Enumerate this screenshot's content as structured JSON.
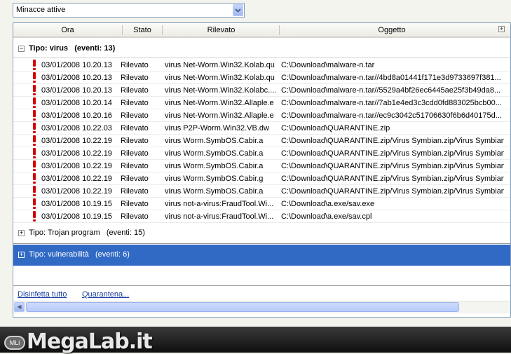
{
  "filter": {
    "selected": "Minacce attive"
  },
  "columns": {
    "ora": "Ora",
    "stato": "Stato",
    "rilevato": "Rilevato",
    "oggetto": "Oggetto"
  },
  "groups": [
    {
      "label": "Tipo: virus   (eventi: 13)",
      "expanded": true,
      "expander": "−"
    },
    {
      "label": "Tipo: Trojan program   (eventi: 15)",
      "expanded": false,
      "expander": "+"
    },
    {
      "label": "Tipo: vulnerabilità   (eventi: 6)",
      "expanded": false,
      "expander": "+",
      "selected": true
    }
  ],
  "rows": [
    {
      "ora": "03/01/2008 10.20.13",
      "stato": "Rilevato",
      "rilevato": "virus Net-Worm.Win32.Kolab.qu",
      "oggetto": "C:\\Download\\malware-n.tar"
    },
    {
      "ora": "03/01/2008 10.20.13",
      "stato": "Rilevato",
      "rilevato": "virus Net-Worm.Win32.Kolab.qu",
      "oggetto": "C:\\Download\\malware-n.tar//4bd8a01441f171e3d9733697f381..."
    },
    {
      "ora": "03/01/2008 10.20.13",
      "stato": "Rilevato",
      "rilevato": "virus Net-Worm.Win32.Kolabc....",
      "oggetto": "C:\\Download\\malware-n.tar//5529a4bf26ec6445ae25f3b49da8..."
    },
    {
      "ora": "03/01/2008 10.20.14",
      "stato": "Rilevato",
      "rilevato": "virus Net-Worm.Win32.Allaple.e",
      "oggetto": "C:\\Download\\malware-n.tar//7ab1e4ed3c3cdd0fd883025bcb00..."
    },
    {
      "ora": "03/01/2008 10.20.16",
      "stato": "Rilevato",
      "rilevato": "virus Net-Worm.Win32.Allaple.e",
      "oggetto": "C:\\Download\\malware-n.tar//ec9c3042c51706630f6b6d40175d..."
    },
    {
      "ora": "03/01/2008 10.22.03",
      "stato": "Rilevato",
      "rilevato": "virus P2P-Worm.Win32.VB.dw",
      "oggetto": "C:\\Download\\QUARANTINE.zip"
    },
    {
      "ora": "03/01/2008 10.22.19",
      "stato": "Rilevato",
      "rilevato": "virus Worm.SymbOS.Cabir.a",
      "oggetto": "C:\\Download\\QUARANTINE.zip/Virus Symbian.zip/Virus Symbian..."
    },
    {
      "ora": "03/01/2008 10.22.19",
      "stato": "Rilevato",
      "rilevato": "virus Worm.SymbOS.Cabir.a",
      "oggetto": "C:\\Download\\QUARANTINE.zip/Virus Symbian.zip/Virus Symbian..."
    },
    {
      "ora": "03/01/2008 10.22.19",
      "stato": "Rilevato",
      "rilevato": "virus Worm.SymbOS.Cabir.a",
      "oggetto": "C:\\Download\\QUARANTINE.zip/Virus Symbian.zip/Virus Symbian..."
    },
    {
      "ora": "03/01/2008 10.22.19",
      "stato": "Rilevato",
      "rilevato": "virus Worm.SymbOS.Cabir.g",
      "oggetto": "C:\\Download\\QUARANTINE.zip/Virus Symbian.zip/Virus Symbian..."
    },
    {
      "ora": "03/01/2008 10.22.19",
      "stato": "Rilevato",
      "rilevato": "virus Worm.SymbOS.Cabir.a",
      "oggetto": "C:\\Download\\QUARANTINE.zip/Virus Symbian.zip/Virus Symbian..."
    },
    {
      "ora": "03/01/2008 10.19.15",
      "stato": "Rilevato",
      "rilevato": "virus not-a-virus:FraudTool.Wi...",
      "oggetto": "C:\\Download\\a.exe/sav.exe"
    },
    {
      "ora": "03/01/2008 10.19.15",
      "stato": "Rilevato",
      "rilevato": "virus not-a-virus:FraudTool.Wi...",
      "oggetto": "C:\\Download\\a.exe/sav.cpl"
    }
  ],
  "actions": {
    "disinfect": "Disinfetta tutto",
    "quarantine": "Quarantena..."
  },
  "watermark": {
    "badge": "MLi",
    "text": "MegaLab.it"
  },
  "colors": {
    "selection": "#316ac5",
    "alert": "#d40000",
    "link": "#1a3fa0"
  }
}
